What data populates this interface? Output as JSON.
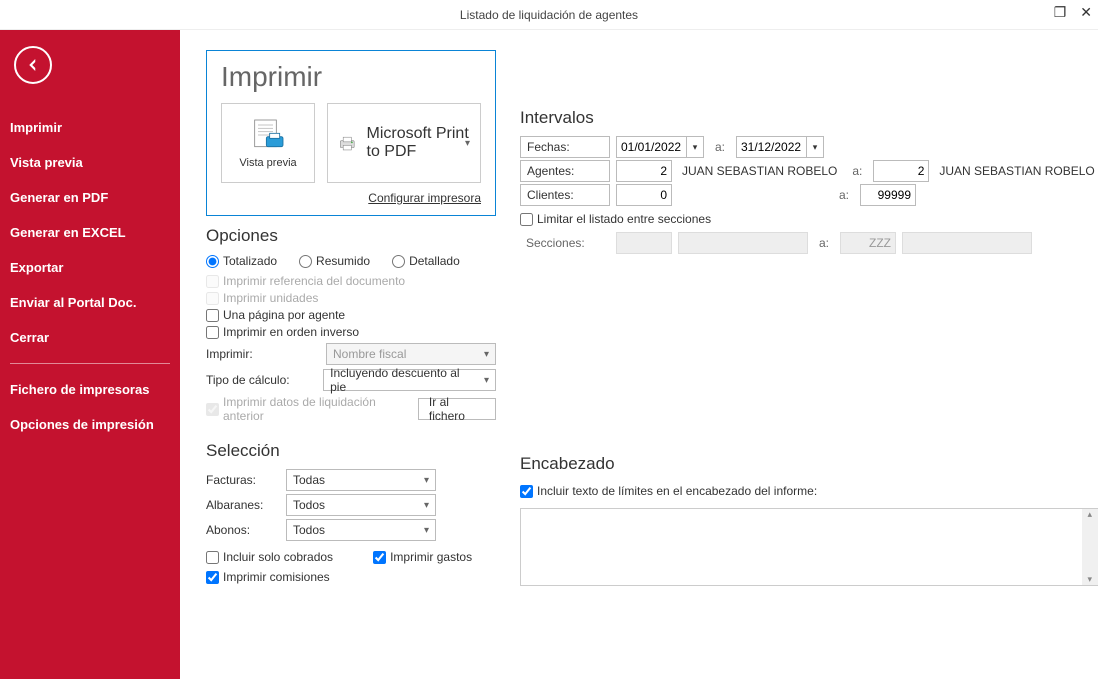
{
  "window": {
    "title": "Listado de liquidación de agentes"
  },
  "sidebar": {
    "items": [
      "Imprimir",
      "Vista previa",
      "Generar en PDF",
      "Generar en EXCEL",
      "Exportar",
      "Enviar al Portal Doc.",
      "Cerrar"
    ],
    "items2": [
      "Fichero de impresoras",
      "Opciones de impresión"
    ]
  },
  "print": {
    "heading": "Imprimir",
    "preview_label": "Vista previa",
    "printer_name": "Microsoft Print to PDF",
    "config_link": "Configurar impresora"
  },
  "options": {
    "heading": "Opciones",
    "radios": {
      "totalizado": "Totalizado",
      "resumido": "Resumido",
      "detallado": "Detallado",
      "selected": "totalizado"
    },
    "ref_doc": "Imprimir referencia del documento",
    "unidades": "Imprimir unidades",
    "una_pagina": "Una página por agente",
    "orden_inverso": "Imprimir en orden inverso",
    "imprimir_lab": "Imprimir:",
    "imprimir_val": "Nombre fiscal",
    "tipo_calc_lab": "Tipo de cálculo:",
    "tipo_calc_val": "Incluyendo descuento al pie",
    "liq_anterior": "Imprimir datos de liquidación anterior",
    "ir_fichero": "Ir al fichero"
  },
  "seleccion": {
    "heading": "Selección",
    "facturas_lab": "Facturas:",
    "facturas_val": "Todas",
    "albaranes_lab": "Albaranes:",
    "albaranes_val": "Todos",
    "abonos_lab": "Abonos:",
    "abonos_val": "Todos",
    "solo_cobrados": "Incluir solo cobrados",
    "imprimir_gastos": "Imprimir gastos",
    "imprimir_comisiones": "Imprimir comisiones"
  },
  "intervalos": {
    "heading": "Intervalos",
    "fechas_lab": "Fechas:",
    "fecha_from": "01/01/2022",
    "fecha_to": "31/12/2022",
    "agentes_lab": "Agentes:",
    "agente_from_num": "2",
    "agente_from_name": "JUAN SEBASTIAN ROBELO",
    "agente_to_num": "2",
    "agente_to_name": "JUAN SEBASTIAN ROBELO",
    "clientes_lab": "Clientes:",
    "cliente_from": "0",
    "cliente_to": "99999",
    "limitar": "Limitar el listado entre secciones",
    "secciones_lab": "Secciones:",
    "sec_from": "",
    "sec_to": "ZZZ",
    "a": "a:"
  },
  "encabezado": {
    "heading": "Encabezado",
    "incluir": "Incluir texto de límites en el encabezado del informe:",
    "text": ""
  }
}
